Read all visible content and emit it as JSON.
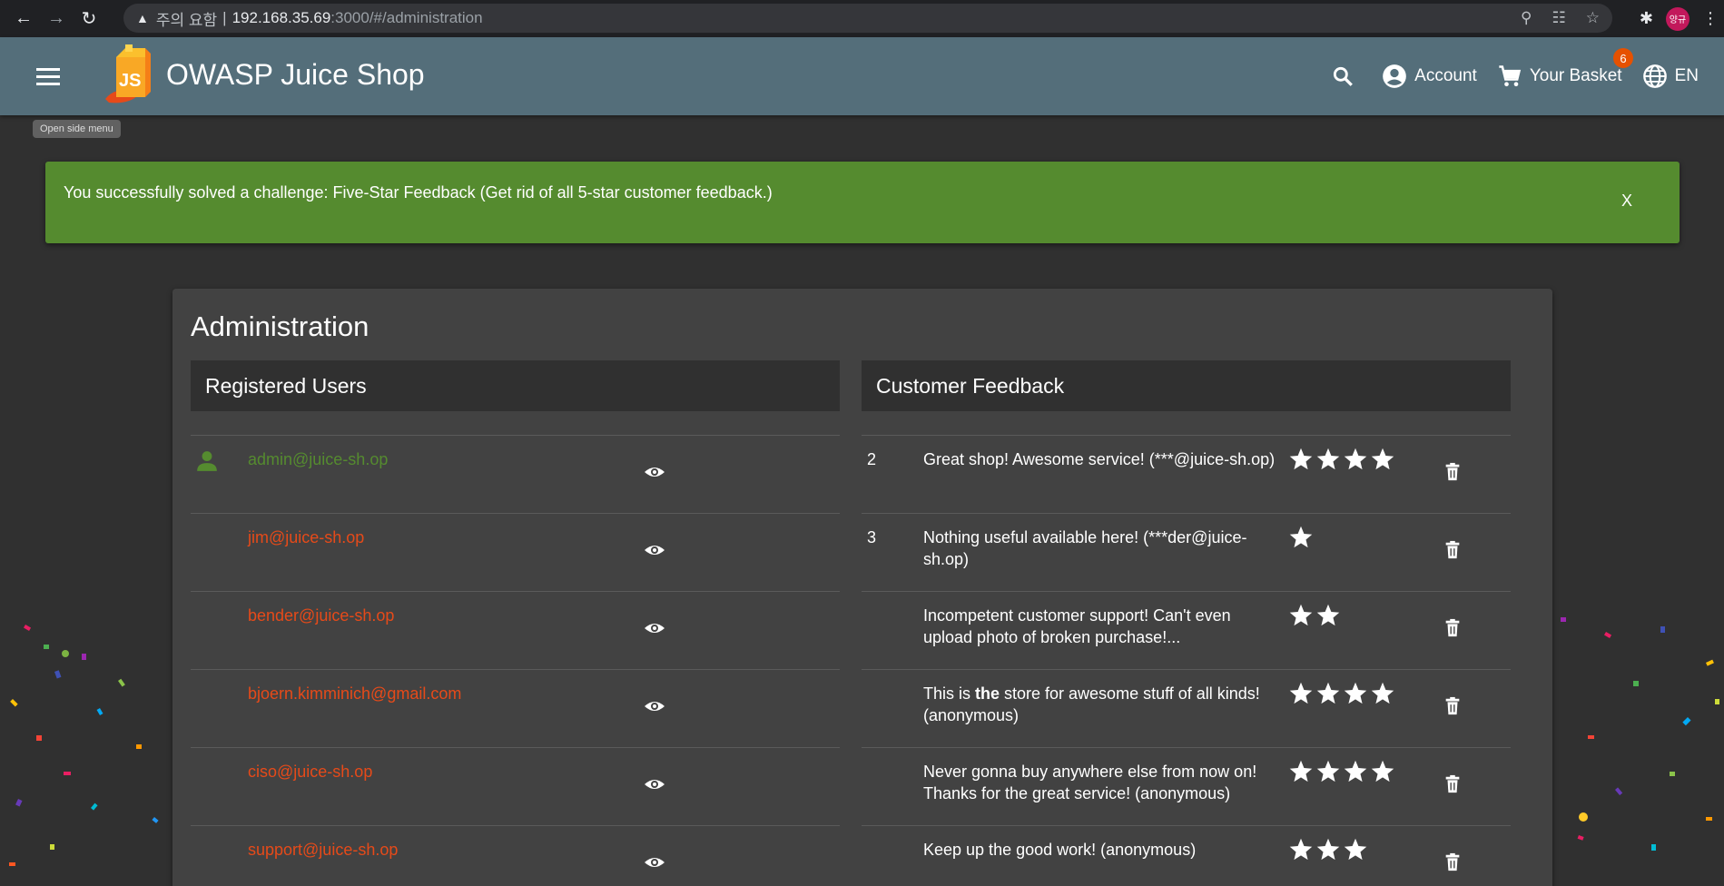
{
  "browser": {
    "security_label": "주의 요함",
    "url_host": "192.168.35.69",
    "url_path": ":3000/#/administration",
    "profile_label": "양규"
  },
  "app": {
    "title": "OWASP Juice Shop",
    "account_label": "Account",
    "basket_label": "Your Basket",
    "basket_count": "6",
    "language_label": "EN",
    "menu_tooltip": "Open side menu"
  },
  "snackbar": {
    "message": "You successfully solved a challenge: Five-Star Feedback (Get rid of all 5-star customer feedback.)",
    "close_label": "X"
  },
  "admin": {
    "title": "Administration",
    "users_heading": "Registered Users",
    "feedback_heading": "Customer Feedback",
    "users": [
      {
        "email": "admin@juice-sh.op",
        "admin": true
      },
      {
        "email": "jim@juice-sh.op",
        "admin": false
      },
      {
        "email": "bender@juice-sh.op",
        "admin": false
      },
      {
        "email": "bjoern.kimminich@gmail.com",
        "admin": false
      },
      {
        "email": "ciso@juice-sh.op",
        "admin": false
      },
      {
        "email": "support@juice-sh.op",
        "admin": false
      }
    ],
    "feedback": [
      {
        "id": "2",
        "text": "Great shop! Awesome service! (***@juice-sh.op)",
        "rating": 4
      },
      {
        "id": "3",
        "text": "Nothing useful available here! (***der@juice-sh.op)",
        "rating": 1
      },
      {
        "id": "",
        "text": "Incompetent customer support! Can't even upload photo of broken purchase!...",
        "rating": 2
      },
      {
        "id": "",
        "text_before": "This is ",
        "text_bold": "the",
        "text_after": " store for awesome stuff of all kinds! (anonymous)",
        "rating": 4
      },
      {
        "id": "",
        "text": "Never gonna buy anywhere else from now on! Thanks for the great service! (anonymous)",
        "rating": 4
      },
      {
        "id": "",
        "text": "Keep up the good work! (anonymous)",
        "rating": 3
      }
    ]
  },
  "colors": {
    "toolbar": "#546e7a",
    "success": "#558b2f",
    "user_link": "#e64a19",
    "admin_link": "#558b2f"
  }
}
